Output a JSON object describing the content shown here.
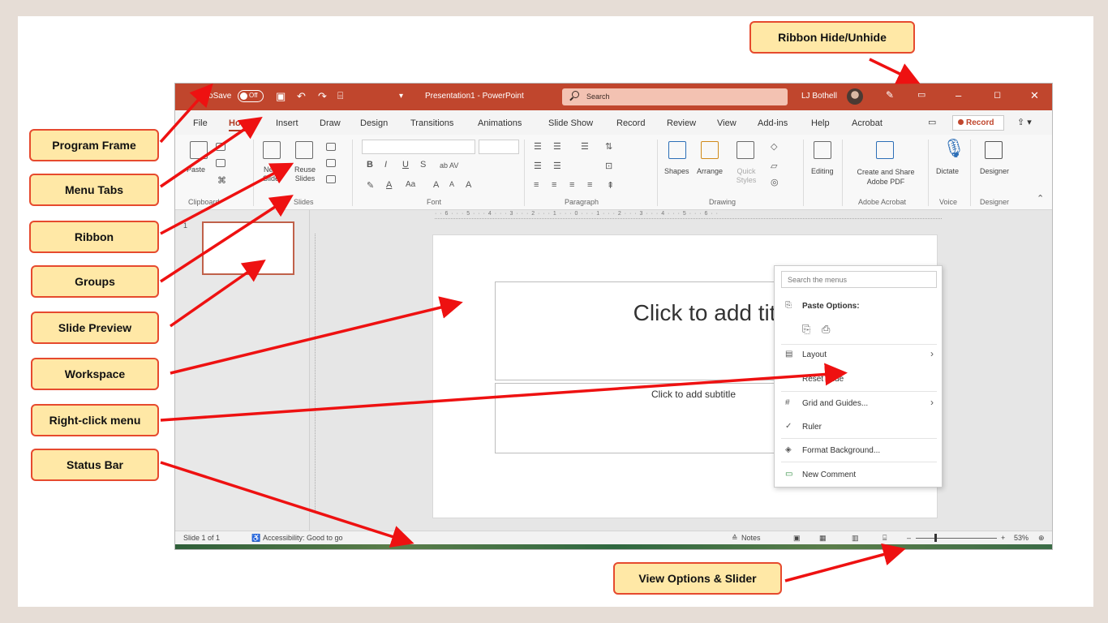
{
  "app": {
    "autosave_label": "AutoSave",
    "autosave_state": "Off",
    "doc_title": "Presentation1 - PowerPoint",
    "search_placeholder": "Search",
    "user_name": "LJ Bothell"
  },
  "tabs": [
    "File",
    "Home",
    "Insert",
    "Draw",
    "Design",
    "Transitions",
    "Animations",
    "Slide Show",
    "Record",
    "Review",
    "View",
    "Add-ins",
    "Help",
    "Acrobat"
  ],
  "active_tab": "Home",
  "record_button": "Record",
  "ribbon": {
    "paste": "Paste",
    "new_slide": "New Slide",
    "reuse_slides": "Reuse Slides",
    "shapes": "Shapes",
    "arrange": "Arrange",
    "quick_styles": "Quick Styles",
    "editing": "Editing",
    "create_share_pdf": "Create and Share Adobe PDF",
    "dictate": "Dictate",
    "designer": "Designer",
    "groups": [
      "Clipboard",
      "Slides",
      "Font",
      "Paragraph",
      "Drawing",
      "Adobe Acrobat",
      "Voice",
      "Designer"
    ]
  },
  "thumbnail_number": "1",
  "slide": {
    "title_placeholder": "Click to add title",
    "subtitle_placeholder": "Click to add subtitle"
  },
  "context_menu": {
    "search_placeholder": "Search the menus",
    "paste_options": "Paste Options:",
    "items": [
      "Layout",
      "Reset Slide",
      "Grid and Guides...",
      "Ruler",
      "Format Background...",
      "New Comment"
    ]
  },
  "status": {
    "slide_count": "Slide 1 of 1",
    "accessibility": "Accessibility: Good to go",
    "notes": "Notes",
    "zoom": "53%"
  },
  "callouts": {
    "ribbon_hide": "Ribbon Hide/Unhide",
    "program_frame": "Program Frame",
    "menu_tabs": "Menu Tabs",
    "ribbon": "Ribbon",
    "groups": "Groups",
    "slide_preview": "Slide Preview",
    "workspace": "Workspace",
    "right_click_menu": "Right-click menu",
    "status_bar": "Status Bar",
    "view_options": "View Options & Slider"
  },
  "colors": {
    "title_bar": "#c0462d",
    "callout_fill": "#ffe8a6",
    "callout_border": "#e64a2e",
    "arrow": "#ee1111"
  }
}
